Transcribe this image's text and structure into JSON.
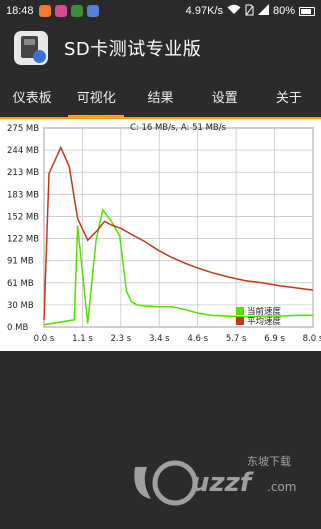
{
  "status_bar": {
    "time": "18:48",
    "net_speed": "4.97K/s",
    "battery": "80%",
    "icons": [
      "app-notification-icon",
      "app-notification-icon",
      "app-notification-icon",
      "app-notification-icon",
      "wifi-icon",
      "no-sim-icon",
      "signal-icon",
      "battery-icon"
    ]
  },
  "app": {
    "title": "SD卡测试专业版",
    "icon": "sd-card-icon"
  },
  "tabs": [
    {
      "label": "仪表板"
    },
    {
      "label": "可视化"
    },
    {
      "label": "结果"
    },
    {
      "label": "设置"
    },
    {
      "label": "关于"
    }
  ],
  "active_tab": 1,
  "chart_data": {
    "type": "line",
    "title": "C: 16 MB/s, A: 51 MB/s",
    "xlabel": "",
    "ylabel": "",
    "y_ticks": [
      "275 MB",
      "244 MB",
      "213 MB",
      "183 MB",
      "152 MB",
      "122 MB",
      "91 MB",
      "61 MB",
      "30 MB",
      "0 MB"
    ],
    "x_ticks": [
      "0.0 s",
      "1.1 s",
      "2.3 s",
      "3.4 s",
      "4.6 s",
      "5.7 s",
      "6.9 s",
      "8.0 s"
    ],
    "xlim": [
      0,
      8.0
    ],
    "ylim": [
      0,
      275
    ],
    "grid": true,
    "legend_position": "bottom-right",
    "series": [
      {
        "name": "当前速度",
        "color": "#55e000",
        "x": [
          0.0,
          0.9,
          1.0,
          1.3,
          1.55,
          1.75,
          2.0,
          2.25,
          2.45,
          2.6,
          2.75,
          3.0,
          3.4,
          3.8,
          4.2,
          4.6,
          5.0,
          5.5,
          6.0,
          6.5,
          7.0,
          7.5,
          8.0
        ],
        "y": [
          3,
          10,
          140,
          5,
          120,
          162,
          146,
          126,
          50,
          35,
          31,
          29,
          28,
          28,
          24,
          19,
          16,
          15,
          14,
          15,
          15,
          16,
          16
        ]
      },
      {
        "name": "平均速度",
        "color": "#c0391b",
        "x": [
          0.0,
          0.15,
          0.5,
          0.75,
          1.0,
          1.3,
          1.6,
          1.8,
          2.0,
          2.3,
          2.6,
          3.0,
          3.4,
          3.8,
          4.2,
          4.6,
          5.0,
          5.5,
          6.0,
          6.5,
          7.0,
          7.5,
          8.0
        ],
        "y": [
          10,
          212,
          248,
          222,
          150,
          120,
          134,
          146,
          141,
          136,
          128,
          118,
          106,
          96,
          88,
          81,
          75,
          69,
          64,
          61,
          57,
          54,
          51
        ]
      }
    ]
  },
  "watermark": {
    "brand": "uzzf",
    "brand_suffix": ".com",
    "tagline": "东坡下载"
  }
}
